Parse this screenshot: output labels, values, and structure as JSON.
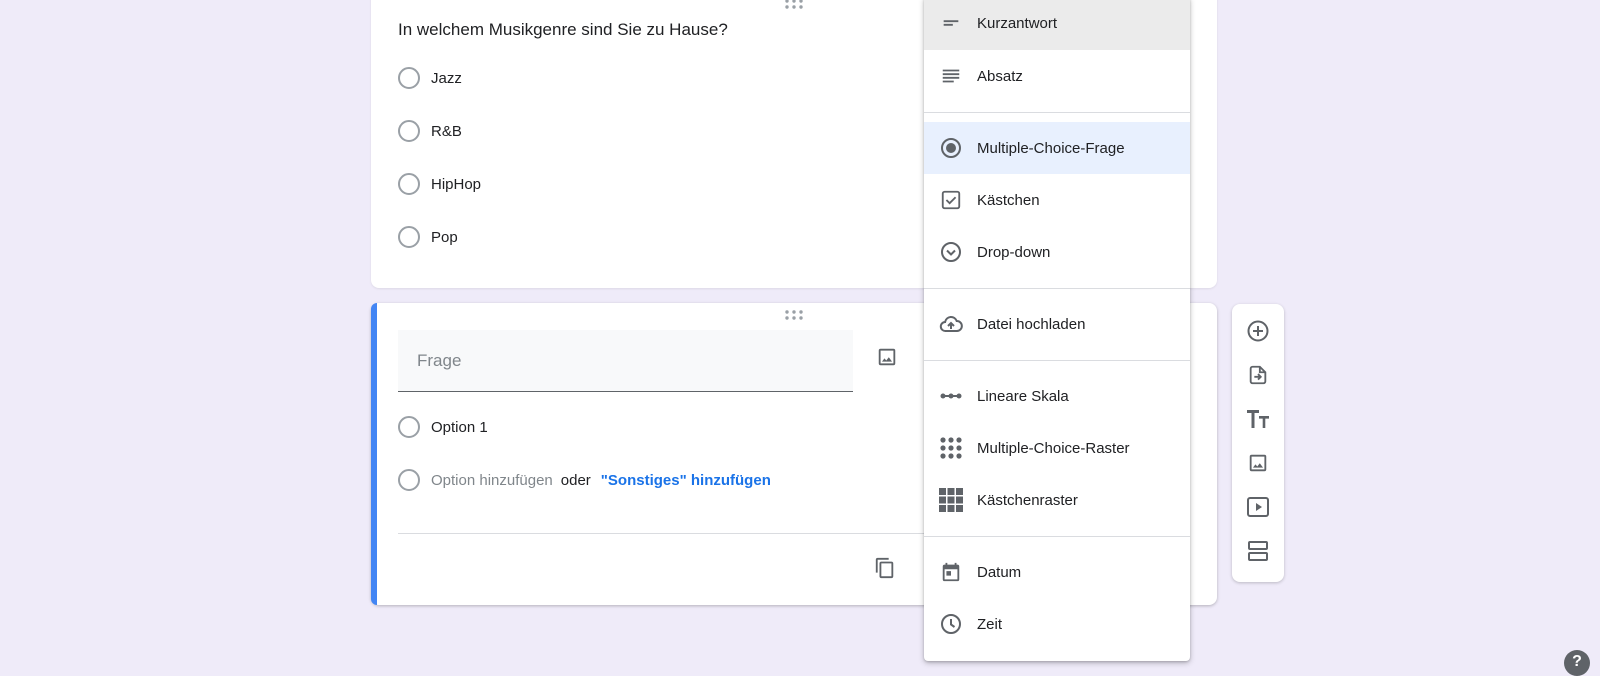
{
  "question_card": {
    "title": "In welchem Musikgenre sind Sie zu Hause?",
    "options": [
      "Jazz",
      "R&B",
      "HipHop",
      "Pop"
    ]
  },
  "active_card": {
    "question_placeholder": "Frage",
    "option_1": "Option 1",
    "add_option": "Option hinzufügen",
    "or": "oder",
    "add_other": "\"Sonstiges\" hinzufügen"
  },
  "type_menu": {
    "items": [
      {
        "label": "Kurzantwort",
        "icon": "short-text-icon",
        "state": "hover"
      },
      {
        "label": "Absatz",
        "icon": "paragraph-icon"
      },
      {
        "label": "Multiple-Choice-Frage",
        "icon": "radio-button-icon",
        "state": "selected"
      },
      {
        "label": "Kästchen",
        "icon": "checkbox-icon"
      },
      {
        "label": "Drop-down",
        "icon": "dropdown-icon"
      },
      {
        "label": "Datei hochladen",
        "icon": "cloud-upload-icon"
      },
      {
        "label": "Lineare Skala",
        "icon": "linear-scale-icon"
      },
      {
        "label": "Multiple-Choice-Raster",
        "icon": "dot-grid-icon"
      },
      {
        "label": "Kästchenraster",
        "icon": "checkbox-grid-icon"
      },
      {
        "label": "Datum",
        "icon": "calendar-icon"
      },
      {
        "label": "Zeit",
        "icon": "clock-icon"
      }
    ]
  },
  "toolbar": {
    "icons": [
      "add-question-icon",
      "import-questions-icon",
      "add-title-icon",
      "add-image-icon",
      "add-video-icon",
      "add-section-icon"
    ]
  },
  "colors": {
    "background": "#efebf9",
    "accent": "#4285f4",
    "link": "#1a73e8",
    "selected_item": "#e8f0fe"
  },
  "help_label": "?"
}
